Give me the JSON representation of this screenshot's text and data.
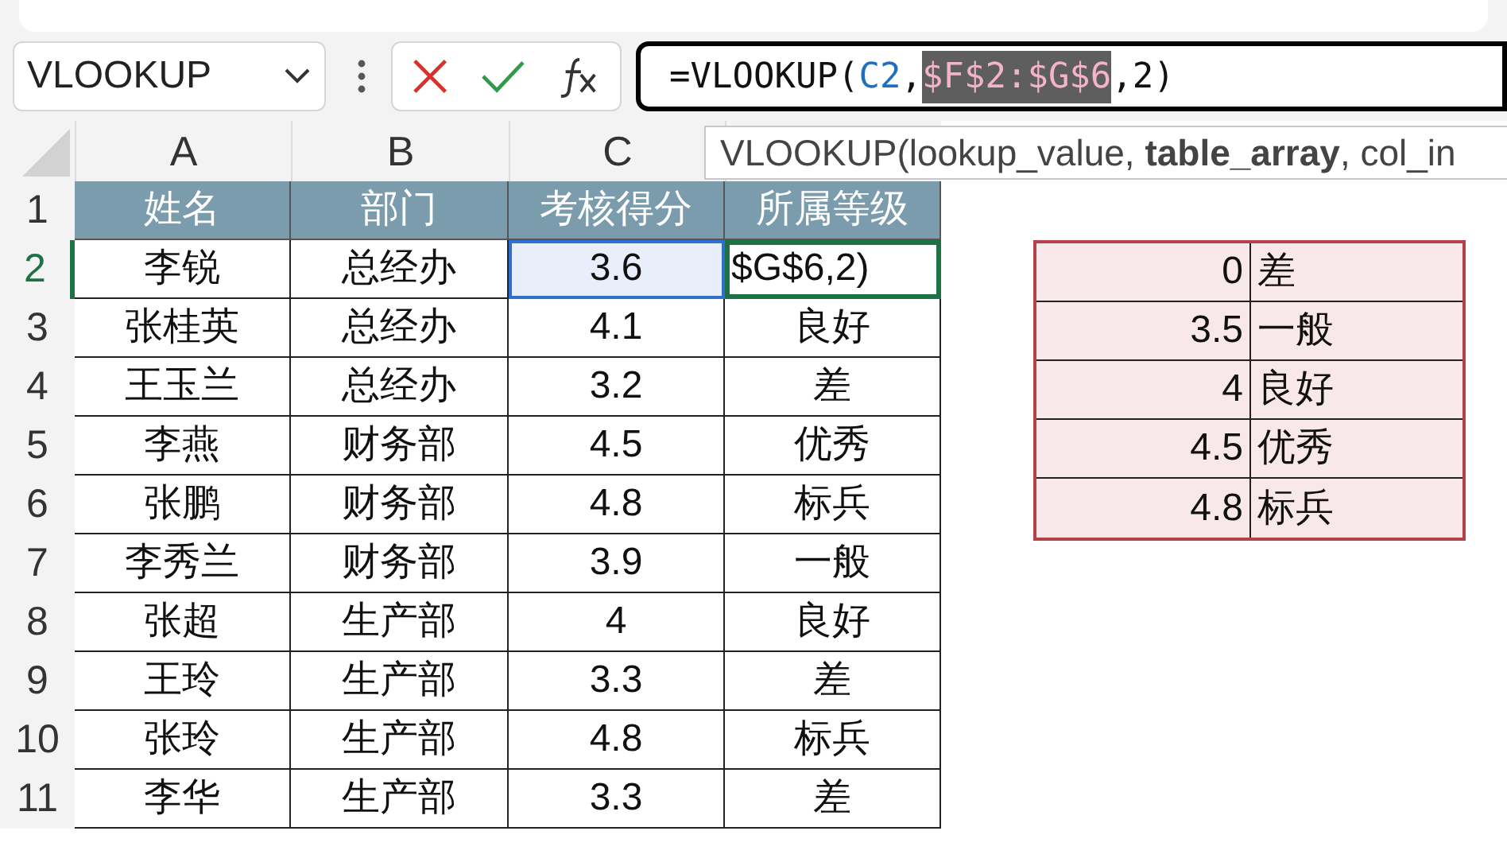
{
  "name_box": {
    "value": "VLOOKUP"
  },
  "formula_bar": {
    "segments": [
      {
        "text": "=VLOOKUP(",
        "selected": false
      },
      {
        "text": "C2",
        "color": "#1f6fbf",
        "selected": false
      },
      {
        "text": ",",
        "selected": false
      },
      {
        "text": "$F$2:$G$6",
        "color": "#f3b3c8",
        "selected": true
      },
      {
        "text": ",2)",
        "selected": false
      }
    ]
  },
  "tooltip": "VLOOKUP(lookup_value, **table_array**, col_in",
  "column_headers": [
    "A",
    "B",
    "C"
  ],
  "rows": [
    {
      "number": "1",
      "active": false,
      "kind": "header",
      "cells": [
        {
          "text": "姓名",
          "in_range": false,
          "editing": false
        },
        {
          "text": "部门",
          "in_range": false,
          "editing": false
        },
        {
          "text": "考核得分",
          "in_range": false,
          "editing": false
        },
        {
          "text": "所属等级",
          "in_range": false,
          "editing": false
        }
      ]
    },
    {
      "number": "2",
      "active": true,
      "kind": "data",
      "cells": [
        {
          "text": "李锐",
          "in_range": false,
          "editing": false
        },
        {
          "text": "总经办",
          "in_range": false,
          "editing": false
        },
        {
          "text": "3.6",
          "in_range": true,
          "editing": false
        },
        {
          "text": "$G$6,2)",
          "in_range": false,
          "editing": true
        }
      ]
    },
    {
      "number": "3",
      "active": false,
      "kind": "data",
      "cells": [
        {
          "text": "张桂英",
          "in_range": false,
          "editing": false
        },
        {
          "text": "总经办",
          "in_range": false,
          "editing": false
        },
        {
          "text": "4.1",
          "in_range": false,
          "editing": false
        },
        {
          "text": "良好",
          "in_range": false,
          "editing": false
        }
      ]
    },
    {
      "number": "4",
      "active": false,
      "kind": "data",
      "cells": [
        {
          "text": "王玉兰",
          "in_range": false,
          "editing": false
        },
        {
          "text": "总经办",
          "in_range": false,
          "editing": false
        },
        {
          "text": "3.2",
          "in_range": false,
          "editing": false
        },
        {
          "text": "差",
          "in_range": false,
          "editing": false
        }
      ]
    },
    {
      "number": "5",
      "active": false,
      "kind": "data",
      "cells": [
        {
          "text": "李燕",
          "in_range": false,
          "editing": false
        },
        {
          "text": "财务部",
          "in_range": false,
          "editing": false
        },
        {
          "text": "4.5",
          "in_range": false,
          "editing": false
        },
        {
          "text": "优秀",
          "in_range": false,
          "editing": false
        }
      ]
    },
    {
      "number": "6",
      "active": false,
      "kind": "data",
      "cells": [
        {
          "text": "张鹏",
          "in_range": false,
          "editing": false
        },
        {
          "text": "财务部",
          "in_range": false,
          "editing": false
        },
        {
          "text": "4.8",
          "in_range": false,
          "editing": false
        },
        {
          "text": "标兵",
          "in_range": false,
          "editing": false
        }
      ]
    },
    {
      "number": "7",
      "active": false,
      "kind": "data",
      "cells": [
        {
          "text": "李秀兰",
          "in_range": false,
          "editing": false
        },
        {
          "text": "财务部",
          "in_range": false,
          "editing": false
        },
        {
          "text": "3.9",
          "in_range": false,
          "editing": false
        },
        {
          "text": "一般",
          "in_range": false,
          "editing": false
        }
      ]
    },
    {
      "number": "8",
      "active": false,
      "kind": "data",
      "cells": [
        {
          "text": "张超",
          "in_range": false,
          "editing": false
        },
        {
          "text": "生产部",
          "in_range": false,
          "editing": false
        },
        {
          "text": "4",
          "in_range": false,
          "editing": false
        },
        {
          "text": "良好",
          "in_range": false,
          "editing": false
        }
      ]
    },
    {
      "number": "9",
      "active": false,
      "kind": "data",
      "cells": [
        {
          "text": "王玲",
          "in_range": false,
          "editing": false
        },
        {
          "text": "生产部",
          "in_range": false,
          "editing": false
        },
        {
          "text": "3.3",
          "in_range": false,
          "editing": false
        },
        {
          "text": "差",
          "in_range": false,
          "editing": false
        }
      ]
    },
    {
      "number": "10",
      "active": false,
      "kind": "data",
      "cells": [
        {
          "text": "张玲",
          "in_range": false,
          "editing": false
        },
        {
          "text": "生产部",
          "in_range": false,
          "editing": false
        },
        {
          "text": "4.8",
          "in_range": false,
          "editing": false
        },
        {
          "text": "标兵",
          "in_range": false,
          "editing": false
        }
      ]
    },
    {
      "number": "11",
      "active": false,
      "kind": "data",
      "cells": [
        {
          "text": "李华",
          "in_range": false,
          "editing": false
        },
        {
          "text": "生产部",
          "in_range": false,
          "editing": false
        },
        {
          "text": "3.3",
          "in_range": false,
          "editing": false
        },
        {
          "text": "差",
          "in_range": false,
          "editing": false
        }
      ]
    }
  ],
  "lookup_table": {
    "rows": [
      {
        "score": "0",
        "grade": "差"
      },
      {
        "score": "3.5",
        "grade": "一般"
      },
      {
        "score": "4",
        "grade": "良好"
      },
      {
        "score": "4.5",
        "grade": "优秀"
      },
      {
        "score": "4.8",
        "grade": "标兵"
      }
    ]
  }
}
